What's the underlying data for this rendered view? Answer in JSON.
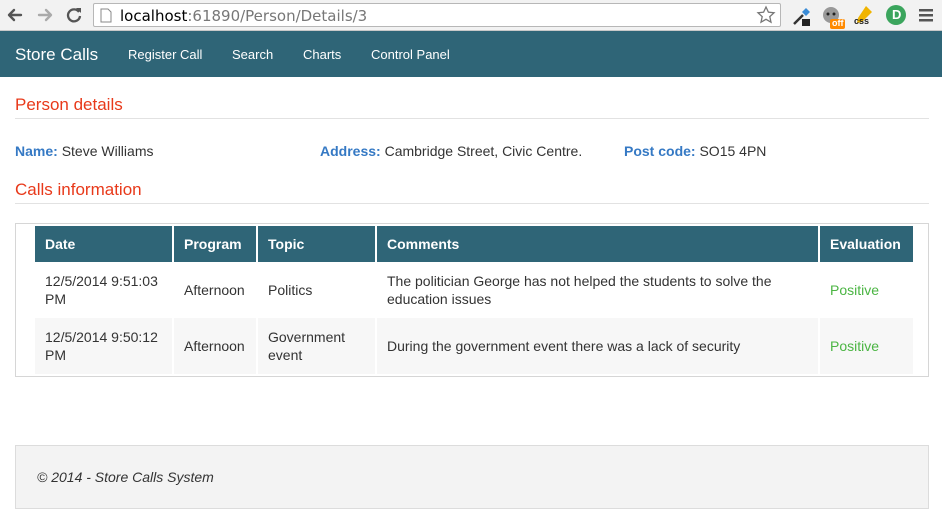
{
  "browser": {
    "url_host": "localhost",
    "url_rest": ":61890/Person/Details/3",
    "icons": [
      "back-icon",
      "forward-icon",
      "reload-icon",
      "page-icon",
      "star-icon",
      "eyedropper-extension-icon",
      "gremlin-extension-icon",
      "css-extension-icon",
      "d-extension-icon",
      "menu-icon"
    ],
    "extension_badge_off": "off",
    "extension_css": "css",
    "extension_d": "D"
  },
  "navbar": {
    "brand": "Store Calls",
    "links": [
      "Register Call",
      "Search",
      "Charts",
      "Control Panel"
    ],
    "color": "#2f6577"
  },
  "person": {
    "title": "Person details",
    "name_label": "Name:",
    "name": "Steve Williams",
    "address_label": "Address:",
    "address": "Cambridge Street, Civic Centre.",
    "postcode_label": "Post code:",
    "postcode": "SO15 4PN"
  },
  "calls": {
    "title": "Calls information",
    "columns": [
      "Date",
      "Program",
      "Topic",
      "Comments",
      "Evaluation"
    ],
    "rows": [
      {
        "date": "12/5/2014 9:51:03 PM",
        "program": "Afternoon",
        "topic": "Politics",
        "comments": "The politician George has not helped the students to solve the education issues",
        "evaluation": "Positive"
      },
      {
        "date": "12/5/2014 9:50:12 PM",
        "program": "Afternoon",
        "topic": "Government event",
        "comments": "During the government event there was a lack of security",
        "evaluation": "Positive"
      }
    ]
  },
  "footer": {
    "text": "© 2014 - Store Calls System"
  },
  "colors": {
    "accent_title": "#e8391a",
    "label": "#3579c4",
    "positive": "#4bb543"
  }
}
